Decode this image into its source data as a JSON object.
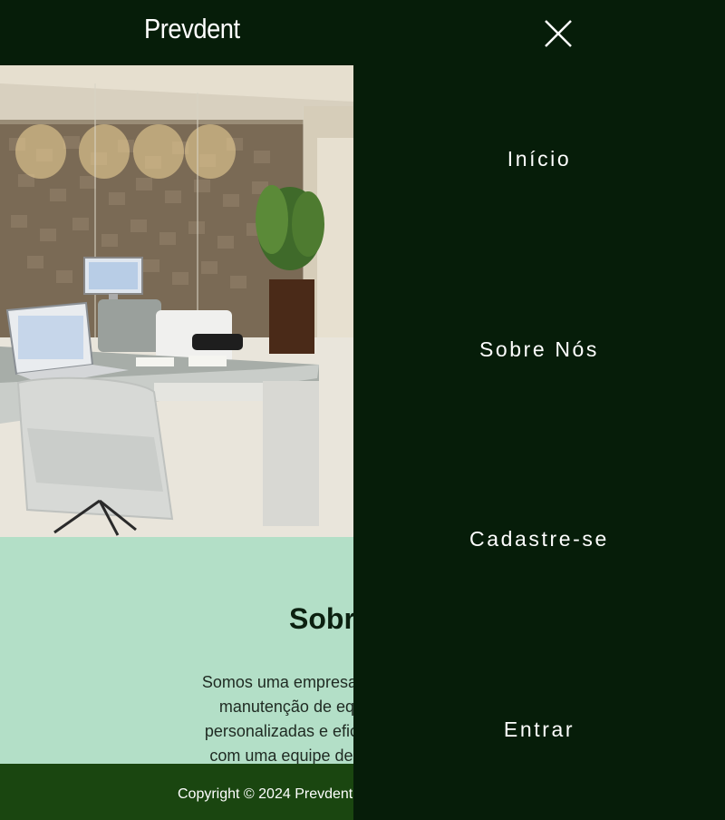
{
  "header": {
    "brand": "Prevdent",
    "close_icon": "close-x-icon"
  },
  "menu": {
    "items": [
      {
        "label": "Início"
      },
      {
        "label": "Sobre Nós"
      },
      {
        "label": "Cadastre-se"
      },
      {
        "label": "Entrar"
      }
    ]
  },
  "about": {
    "title": "Sobr",
    "lines": [
      "Somos uma empresa especializada no dese",
      "manutenção de equipamentos odontoló",
      "personalizadas e eficientes para atender às",
      "com uma equipe de profissionais altament"
    ]
  },
  "footer": {
    "copyright": "Copyright © 2024 Prevdent"
  },
  "colors": {
    "header_bg": "#061d09",
    "page_bg": "#b3dfc7",
    "footer_bg": "#1a4610",
    "menu_bg": "#061d09"
  }
}
